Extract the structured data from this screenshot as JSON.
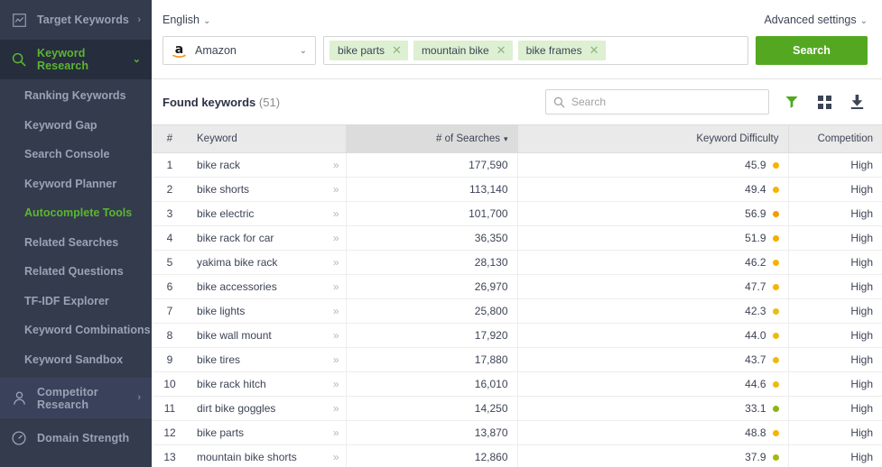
{
  "sidebar": {
    "groups": [
      {
        "id": "target-keywords",
        "label": "Target Keywords",
        "icon": "chart-box-icon",
        "caret": "›",
        "active": false,
        "children": []
      },
      {
        "id": "keyword-research",
        "label": "Keyword Research",
        "icon": "search-icon",
        "caret": "⌄",
        "active": true,
        "children": [
          {
            "label": "Ranking Keywords",
            "selected": false
          },
          {
            "label": "Keyword Gap",
            "selected": false
          },
          {
            "label": "Search Console",
            "selected": false
          },
          {
            "label": "Keyword Planner",
            "selected": false
          },
          {
            "label": "Autocomplete Tools",
            "selected": true
          },
          {
            "label": "Related Searches",
            "selected": false
          },
          {
            "label": "Related Questions",
            "selected": false
          },
          {
            "label": "TF-IDF Explorer",
            "selected": false
          },
          {
            "label": "Keyword Combinations",
            "selected": false
          },
          {
            "label": "Keyword Sandbox",
            "selected": false
          }
        ]
      },
      {
        "id": "competitor-research",
        "label": "Competitor Research",
        "icon": "person-icon",
        "caret": "›",
        "active": false,
        "children": []
      },
      {
        "id": "domain-strength",
        "label": "Domain Strength",
        "icon": "gauge-icon",
        "caret": "",
        "active": false,
        "children": []
      }
    ],
    "colors": {
      "bg": "#333b4d",
      "active_bg": "#262d3c",
      "accent": "#5cb531",
      "text": "#9aa3b5"
    }
  },
  "topbar": {
    "language": "English",
    "language_caret": "⌄",
    "advanced_settings": "Advanced settings",
    "advanced_caret": "⌄",
    "engine": {
      "name": "Amazon",
      "logo": "amazon-logo",
      "caret": "⌄"
    },
    "tags": [
      {
        "label": "bike parts",
        "close": "✕"
      },
      {
        "label": "mountain bike",
        "close": "✕"
      },
      {
        "label": "bike frames",
        "close": "✕"
      }
    ],
    "search_button": "Search",
    "search_button_color": "#54a821"
  },
  "results": {
    "title": "Found keywords",
    "count": "(51)",
    "search_placeholder": "Search",
    "search_value": "",
    "icons": [
      {
        "name": "filter-icon",
        "color": "#54a821"
      },
      {
        "name": "columns-grid-icon",
        "color": "#3d4457"
      },
      {
        "name": "download-icon",
        "color": "#3d4457"
      }
    ]
  },
  "table": {
    "columns": [
      {
        "key": "num",
        "label": "#",
        "align": "center",
        "sorted": false
      },
      {
        "key": "keyword",
        "label": "Keyword",
        "align": "left",
        "sorted": false
      },
      {
        "key": "searches",
        "label": "# of Searches",
        "align": "right",
        "sorted": true,
        "sort_caret": "▾"
      },
      {
        "key": "difficulty",
        "label": "Keyword Difficulty",
        "align": "right",
        "sorted": false
      },
      {
        "key": "competition",
        "label": "Competition",
        "align": "right",
        "sorted": false
      }
    ],
    "row_expand_icon": "»",
    "rows": [
      {
        "num": "1",
        "keyword": "bike rack",
        "searches": "177,590",
        "difficulty": "45.9",
        "dot": "#f5b400",
        "competition": "High"
      },
      {
        "num": "2",
        "keyword": "bike shorts",
        "searches": "113,140",
        "difficulty": "49.4",
        "dot": "#f5b400",
        "competition": "High"
      },
      {
        "num": "3",
        "keyword": "bike electric",
        "searches": "101,700",
        "difficulty": "56.9",
        "dot": "#f59b00",
        "competition": "High"
      },
      {
        "num": "4",
        "keyword": "bike rack for car",
        "searches": "36,350",
        "difficulty": "51.9",
        "dot": "#f5ad00",
        "competition": "High"
      },
      {
        "num": "5",
        "keyword": "yakima bike rack",
        "searches": "28,130",
        "difficulty": "46.2",
        "dot": "#f5b400",
        "competition": "High"
      },
      {
        "num": "6",
        "keyword": "bike accessories",
        "searches": "26,970",
        "difficulty": "47.7",
        "dot": "#f5b400",
        "competition": "High"
      },
      {
        "num": "7",
        "keyword": "bike lights",
        "searches": "25,800",
        "difficulty": "42.3",
        "dot": "#e8be12",
        "competition": "High"
      },
      {
        "num": "8",
        "keyword": "bike wall mount",
        "searches": "17,920",
        "difficulty": "44.0",
        "dot": "#edbb0c",
        "competition": "High"
      },
      {
        "num": "9",
        "keyword": "bike tires",
        "searches": "17,880",
        "difficulty": "43.7",
        "dot": "#edbb0c",
        "competition": "High"
      },
      {
        "num": "10",
        "keyword": "bike rack hitch",
        "searches": "16,010",
        "difficulty": "44.6",
        "dot": "#edbb0c",
        "competition": "High"
      },
      {
        "num": "11",
        "keyword": "dirt bike goggles",
        "searches": "14,250",
        "difficulty": "33.1",
        "dot": "#8fb315",
        "competition": "High"
      },
      {
        "num": "12",
        "keyword": "bike parts",
        "searches": "13,870",
        "difficulty": "48.8",
        "dot": "#f5b400",
        "competition": "High"
      },
      {
        "num": "13",
        "keyword": "mountain bike shorts",
        "searches": "12,860",
        "difficulty": "37.9",
        "dot": "#a8b711",
        "competition": "High"
      }
    ]
  }
}
